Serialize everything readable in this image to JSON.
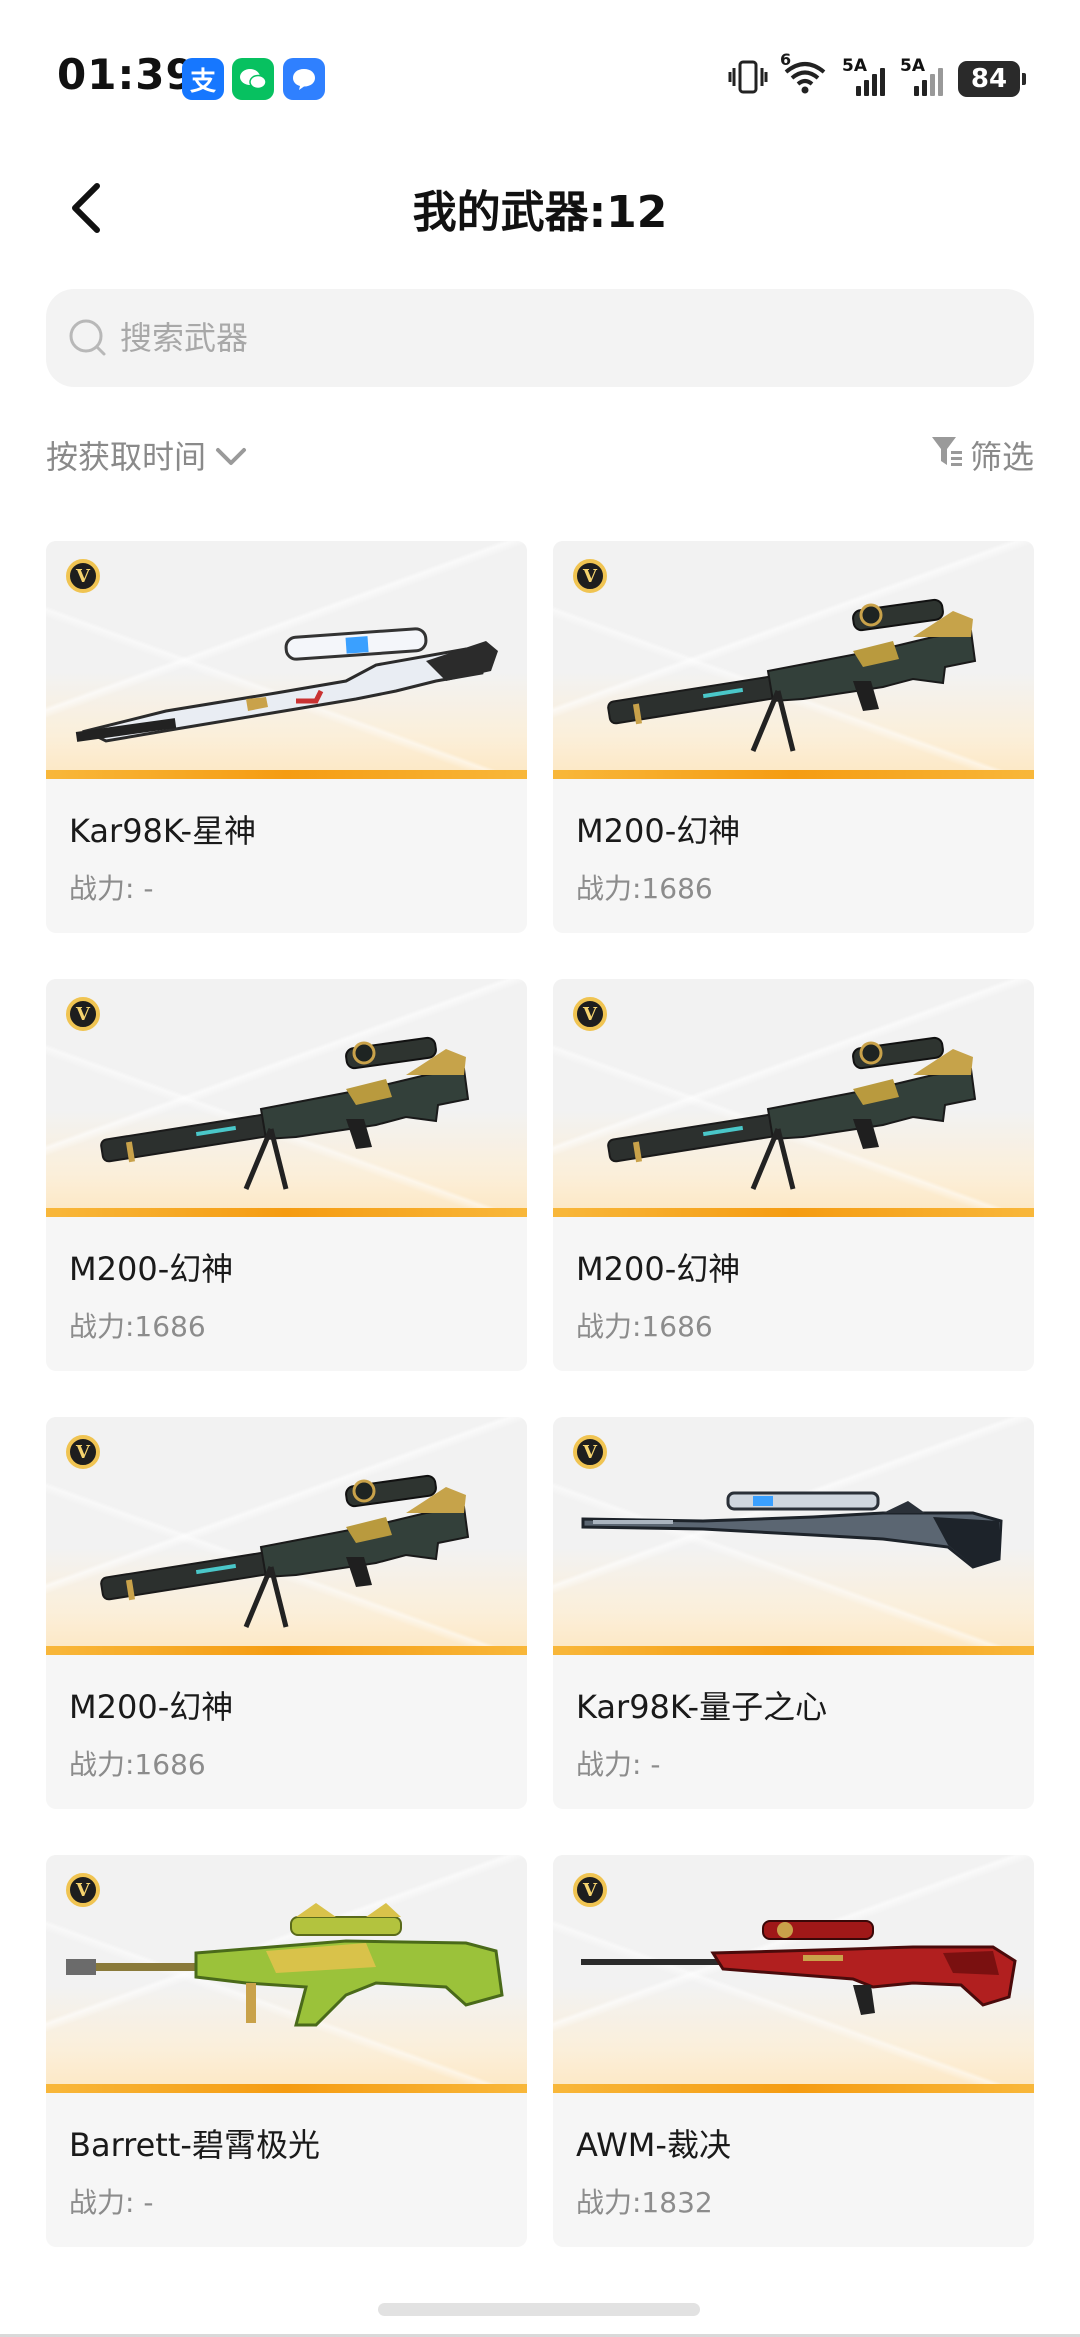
{
  "status_bar": {
    "time": "01:39",
    "app_icons": [
      {
        "name": "alipay-icon",
        "glyph": "支",
        "color": "#1677ff"
      },
      {
        "name": "wechat-icon",
        "glyph": "✉",
        "color": "#07c160"
      },
      {
        "name": "message-icon",
        "glyph": "●",
        "color": "#2f80ff"
      }
    ],
    "wifi_tag": "6",
    "signal_1_tag": "5A",
    "signal_2_tag": "5A",
    "battery_level": "84"
  },
  "header": {
    "title": "我的武器:12",
    "back_icon": "chevron-left-icon"
  },
  "search": {
    "placeholder": "搜索武器",
    "icon": "search-icon"
  },
  "sort": {
    "label": "按获取时间"
  },
  "filter": {
    "label": "筛选"
  },
  "weapons": [
    {
      "name": "Kar98K-星神",
      "power": "战力: -",
      "grade": "V",
      "style": "kar-white"
    },
    {
      "name": "M200-幻神",
      "power": "战力:1686",
      "grade": "V",
      "style": "m200"
    },
    {
      "name": "M200-幻神",
      "power": "战力:1686",
      "grade": "V",
      "style": "m200"
    },
    {
      "name": "M200-幻神",
      "power": "战力:1686",
      "grade": "V",
      "style": "m200"
    },
    {
      "name": "M200-幻神",
      "power": "战力:1686",
      "grade": "V",
      "style": "m200"
    },
    {
      "name": "Kar98K-量子之心",
      "power": "战力: -",
      "grade": "V",
      "style": "kar-dark"
    },
    {
      "name": "Barrett-碧霄极光",
      "power": "战力: -",
      "grade": "V",
      "style": "barrett"
    },
    {
      "name": "AWM-裁决",
      "power": "战力:1832",
      "grade": "V",
      "style": "awm"
    }
  ],
  "colors": {
    "accent_orange": "#f59c12",
    "card_bg": "#f6f6f6",
    "muted_text": "#8c8c8c"
  }
}
